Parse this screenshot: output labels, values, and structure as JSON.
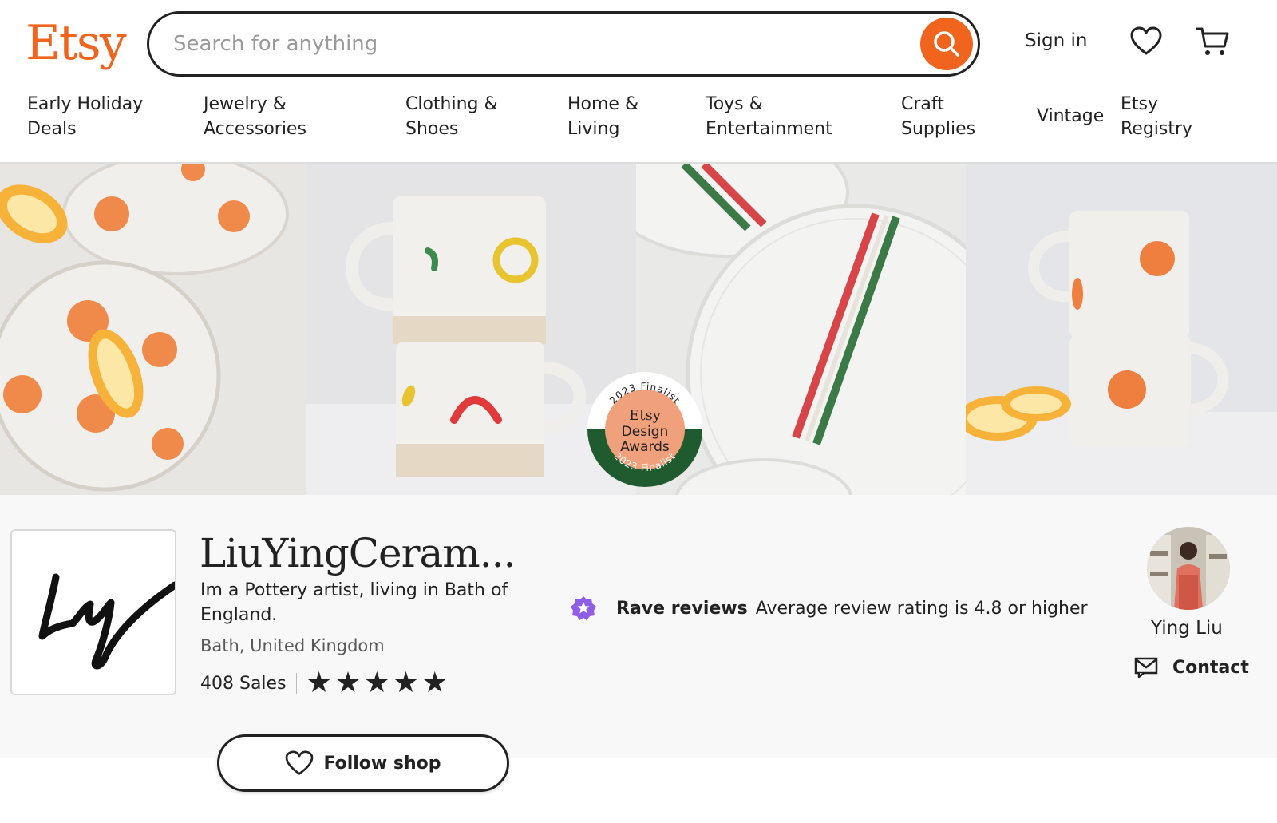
{
  "header": {
    "logo": "Etsy",
    "search_placeholder": "Search for anything",
    "sign_in": "Sign in"
  },
  "nav": [
    {
      "label": "Early Holiday Deals"
    },
    {
      "label": "Jewelry & Accessories"
    },
    {
      "label": "Clothing & Shoes"
    },
    {
      "label": "Home & Living"
    },
    {
      "label": "Toys & Entertainment"
    },
    {
      "label": "Craft Supplies"
    },
    {
      "label": "Vintage"
    },
    {
      "label": "Etsy Registry"
    }
  ],
  "nav_lines": [
    [
      "Early Holiday",
      "Deals"
    ],
    [
      "Jewelry &",
      "Accessories"
    ],
    [
      "Clothing &",
      "Shoes"
    ],
    [
      "Home &",
      "Living"
    ],
    [
      "Toys &",
      "Entertainment"
    ],
    [
      "Craft",
      "Supplies"
    ],
    [
      "Vintage"
    ],
    [
      "Etsy",
      "Registry"
    ]
  ],
  "badge": {
    "top_text": "2023 Finalist",
    "bottom_text": "2023 Finalist",
    "line1": "Etsy",
    "line2": "Design",
    "line3": "Awards"
  },
  "shop": {
    "logo_text": "Ly",
    "name": "LiuYingCeram...",
    "description": "Im a Pottery artist, living in Bath of England.",
    "location": "Bath, United Kingdom",
    "sales": "408 Sales",
    "rating_stars": 5,
    "rave_title": "Rave reviews",
    "rave_text": "Average review rating is 4.8 or higher",
    "owner_name": "Ying Liu",
    "contact_label": "Contact",
    "follow_label": "Follow shop"
  },
  "colors": {
    "brand": "#F1641E",
    "rave_badge": "#8F5EE8",
    "badge_green": "#1F5B2E",
    "badge_orange": "#F0A07A"
  }
}
